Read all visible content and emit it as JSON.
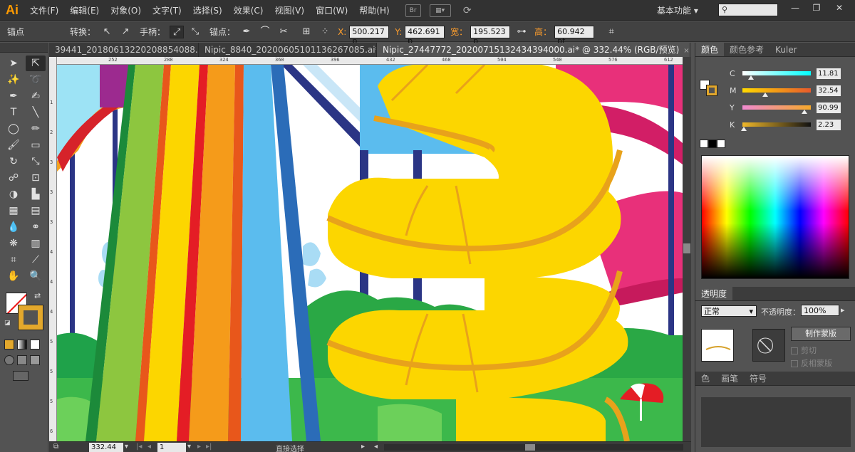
{
  "app": {
    "logo": "Ai",
    "workspace": "基本功能",
    "workspace_arrow": "▾"
  },
  "menu": [
    "文件(F)",
    "编辑(E)",
    "对象(O)",
    "文字(T)",
    "选择(S)",
    "效果(C)",
    "视图(V)",
    "窗口(W)",
    "帮助(H)"
  ],
  "menubar_icons": {
    "bridge": "Br",
    "arrange": "▦▾",
    "sync": "⟳"
  },
  "window_controls": {
    "minimize": "—",
    "restore": "❐",
    "close": "✕"
  },
  "control": {
    "selection": "锚点",
    "convert_label": "转换：",
    "handles_label": "手柄：",
    "anchors_label": "锚点：",
    "x_label": "X:",
    "x_value": "500.217 p",
    "y_label": "Y:",
    "y_value": "462.691 p",
    "w_label": "宽：",
    "w_value": "195.523 p",
    "h_label": "高：",
    "h_value": "60.942 pt"
  },
  "tabs": [
    {
      "label": "39441_20180613220208854088.ai*",
      "active": false
    },
    {
      "label": "Nipic_8840_20200605101136267085.ai*",
      "active": false
    },
    {
      "label": "Nipic_27447772_20200715132434394000.ai* @ 332.44% (RGB/预览)",
      "active": true
    }
  ],
  "tab_close": "×",
  "ruler_top_ticks": [
    "252",
    "288",
    "324",
    "360",
    "396",
    "432",
    "468",
    "504",
    "540",
    "576",
    "612"
  ],
  "ruler_left_ticks": [
    "1",
    "2",
    "3",
    "3",
    "3",
    "4",
    "4",
    "4",
    "5",
    "5",
    "5",
    "6"
  ],
  "status": {
    "zoom": "332.44",
    "page": "1",
    "tool": "直接选择"
  },
  "color_panel": {
    "tabs": [
      "颜色",
      "颜色参考",
      "Kuler"
    ],
    "channels": [
      {
        "name": "C",
        "value": "11.81",
        "pos": 0.12,
        "gradient": "linear-gradient(to right,#fff,#0ff)"
      },
      {
        "name": "M",
        "value": "32.54",
        "pos": 0.33,
        "gradient": "linear-gradient(to right,#ffd900,#e85a2c)"
      },
      {
        "name": "Y",
        "value": "90.99",
        "pos": 0.91,
        "gradient": "linear-gradient(to right,#f08ad0,#f5a82a)"
      },
      {
        "name": "K",
        "value": "2.23",
        "pos": 0.02,
        "gradient": "linear-gradient(to right,#f0b82a,#111)"
      }
    ]
  },
  "transparency_panel": {
    "title": "透明度",
    "blend_mode": "正常",
    "opacity_label": "不透明度：",
    "opacity_value": "100%",
    "make_mask": "制作蒙版",
    "clip": "剪切",
    "invert_mask": "反相蒙版"
  },
  "bottom_panel_tabs": [
    "色",
    "画笔",
    "符号"
  ],
  "colors": {
    "stroke": "#e3a82c",
    "slide_yellow": "#fcd600",
    "slide_stroke": "#e8a21b",
    "pink": "#e8307a",
    "navy": "#2b3585"
  }
}
